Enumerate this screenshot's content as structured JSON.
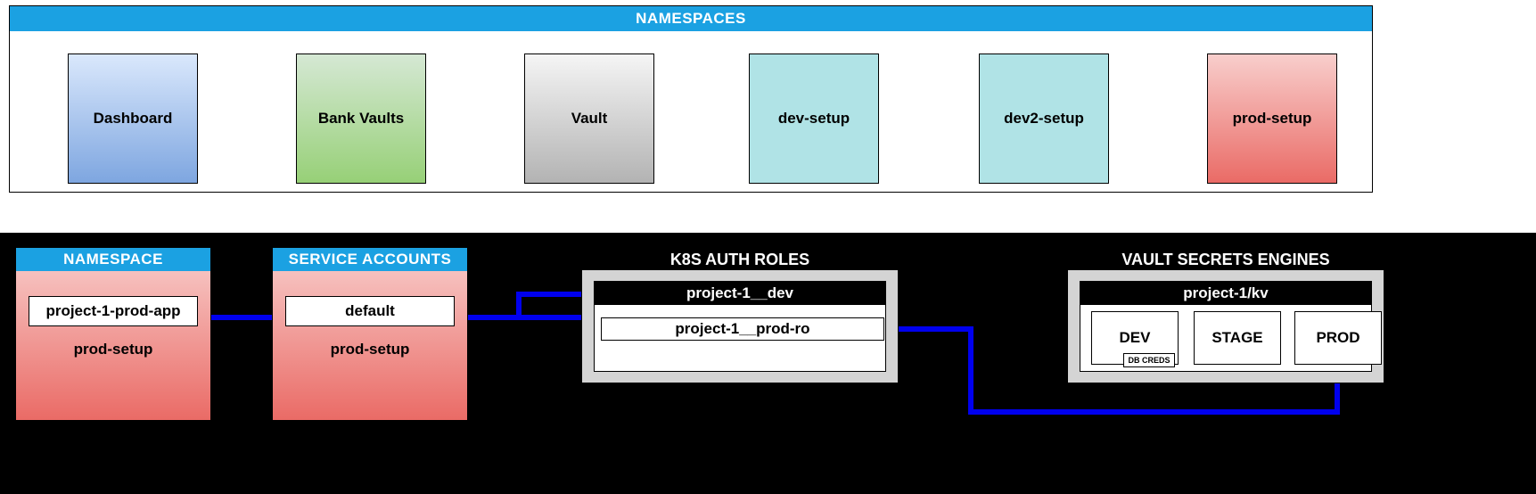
{
  "namespaces": {
    "title": "NAMESPACES",
    "items": [
      "Dashboard",
      "Bank Vaults",
      "Vault",
      "dev-setup",
      "dev2-setup",
      "prod-setup"
    ]
  },
  "namespace_card": {
    "title": "NAMESPACE",
    "box": "project-1-prod-app",
    "sub": "prod-setup"
  },
  "sa_card": {
    "title": "SERVICE ACCOUNTS",
    "box": "default",
    "sub": "prod-setup"
  },
  "roles": {
    "title": "K8S AUTH ROLES",
    "panel_header": "project-1__dev",
    "entry": "project-1__prod-ro"
  },
  "secrets": {
    "title": "VAULT SECRETS ENGINES",
    "panel_header": "project-1/kv",
    "boxes": [
      "DEV",
      "STAGE",
      "PROD"
    ],
    "db_creds": "DB CREDS"
  },
  "chart_data": {
    "type": "table",
    "description": "Kubernetes/Vault architecture diagram",
    "namespaces": [
      "Dashboard",
      "Bank Vaults",
      "Vault",
      "dev-setup",
      "dev2-setup",
      "prod-setup"
    ],
    "namespace_deployment": {
      "name": "project-1-prod-app",
      "namespace": "prod-setup"
    },
    "service_account": {
      "name": "default",
      "namespace": "prod-setup"
    },
    "k8s_auth_roles": {
      "group": "project-1__dev",
      "role": "project-1__prod-ro"
    },
    "vault_secrets_engines": {
      "mount": "project-1/kv",
      "environments": [
        "DEV",
        "STAGE",
        "PROD"
      ],
      "dev_has": "DB CREDS"
    },
    "connections": [
      [
        "project-1-prod-app",
        "default"
      ],
      [
        "default",
        "project-1__prod-ro"
      ],
      [
        "project-1__prod-ro",
        "PROD"
      ]
    ]
  }
}
